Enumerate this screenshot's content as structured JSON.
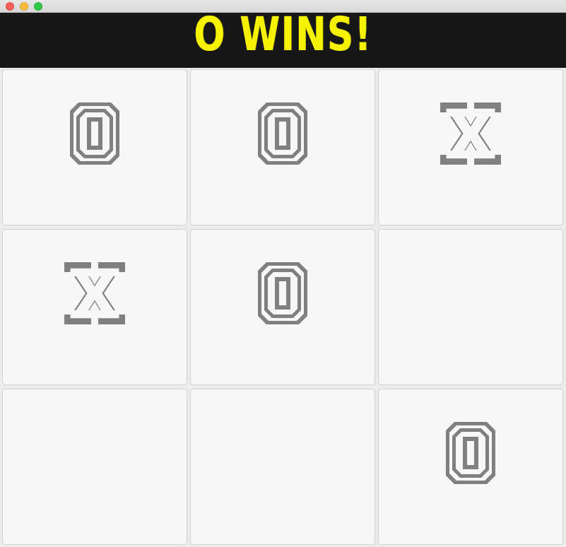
{
  "window": {
    "buttons": [
      "close",
      "minimize",
      "zoom"
    ]
  },
  "banner": {
    "message": "O WINS!",
    "color": "#f6f200",
    "background": "#171717"
  },
  "board": {
    "rows": 3,
    "cols": 3,
    "cells": [
      "O",
      "O",
      "X",
      "X",
      "O",
      "",
      "",
      "",
      "O"
    ],
    "mark_color": "#808080"
  }
}
